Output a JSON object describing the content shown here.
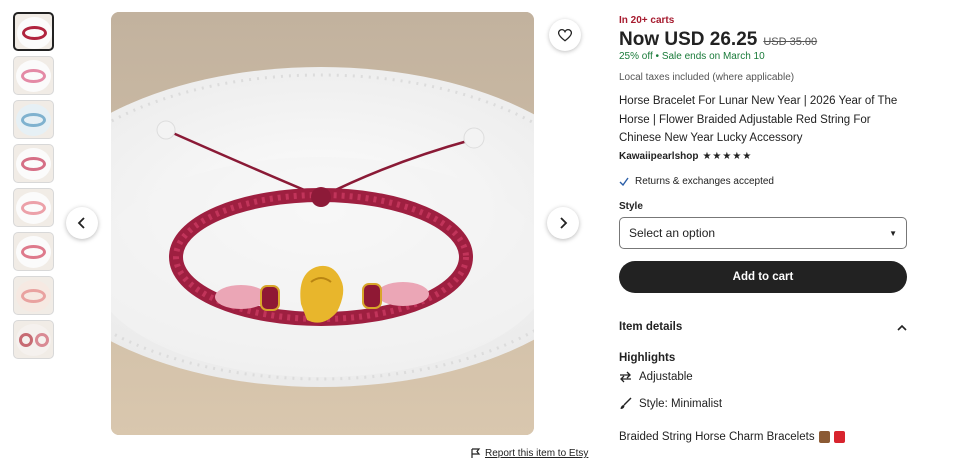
{
  "listing": {
    "carts_badge": "In 20+ carts",
    "price_now": "Now USD 26.25",
    "price_was": "USD 35.00",
    "discount": "25% off",
    "separator": "•",
    "sale_ends": "Sale ends on March 10",
    "taxes_note": "Local taxes included (where applicable)",
    "title": "Horse Bracelet For Lunar New Year | 2026 Year of The Horse | Flower Braided Adjustable Red String For Chinese New Year Lucky Accessory",
    "shop_name": "Kawaiipearlshop",
    "rating_stars": "★★★★★",
    "returns_label": "Returns & exchanges accepted",
    "style_label": "Style",
    "style_select_value": "Select an option",
    "add_to_cart_label": "Add to cart",
    "item_details_label": "Item details",
    "highlights_label": "Highlights",
    "highlights": [
      {
        "icon": "swap-arrows-icon",
        "label": "Adjustable"
      },
      {
        "icon": "brush-icon",
        "label": "Style: Minimalist"
      }
    ],
    "description_line": "Braided String Horse Charm Bracelets"
  },
  "gallery": {
    "thumbnail_count": 8,
    "selected_index": 0,
    "report_label": "Report this item to Etsy"
  },
  "colors": {
    "accent_red": "#a61a2e",
    "sale_green": "#1a7b3a",
    "button_black": "#222222"
  }
}
